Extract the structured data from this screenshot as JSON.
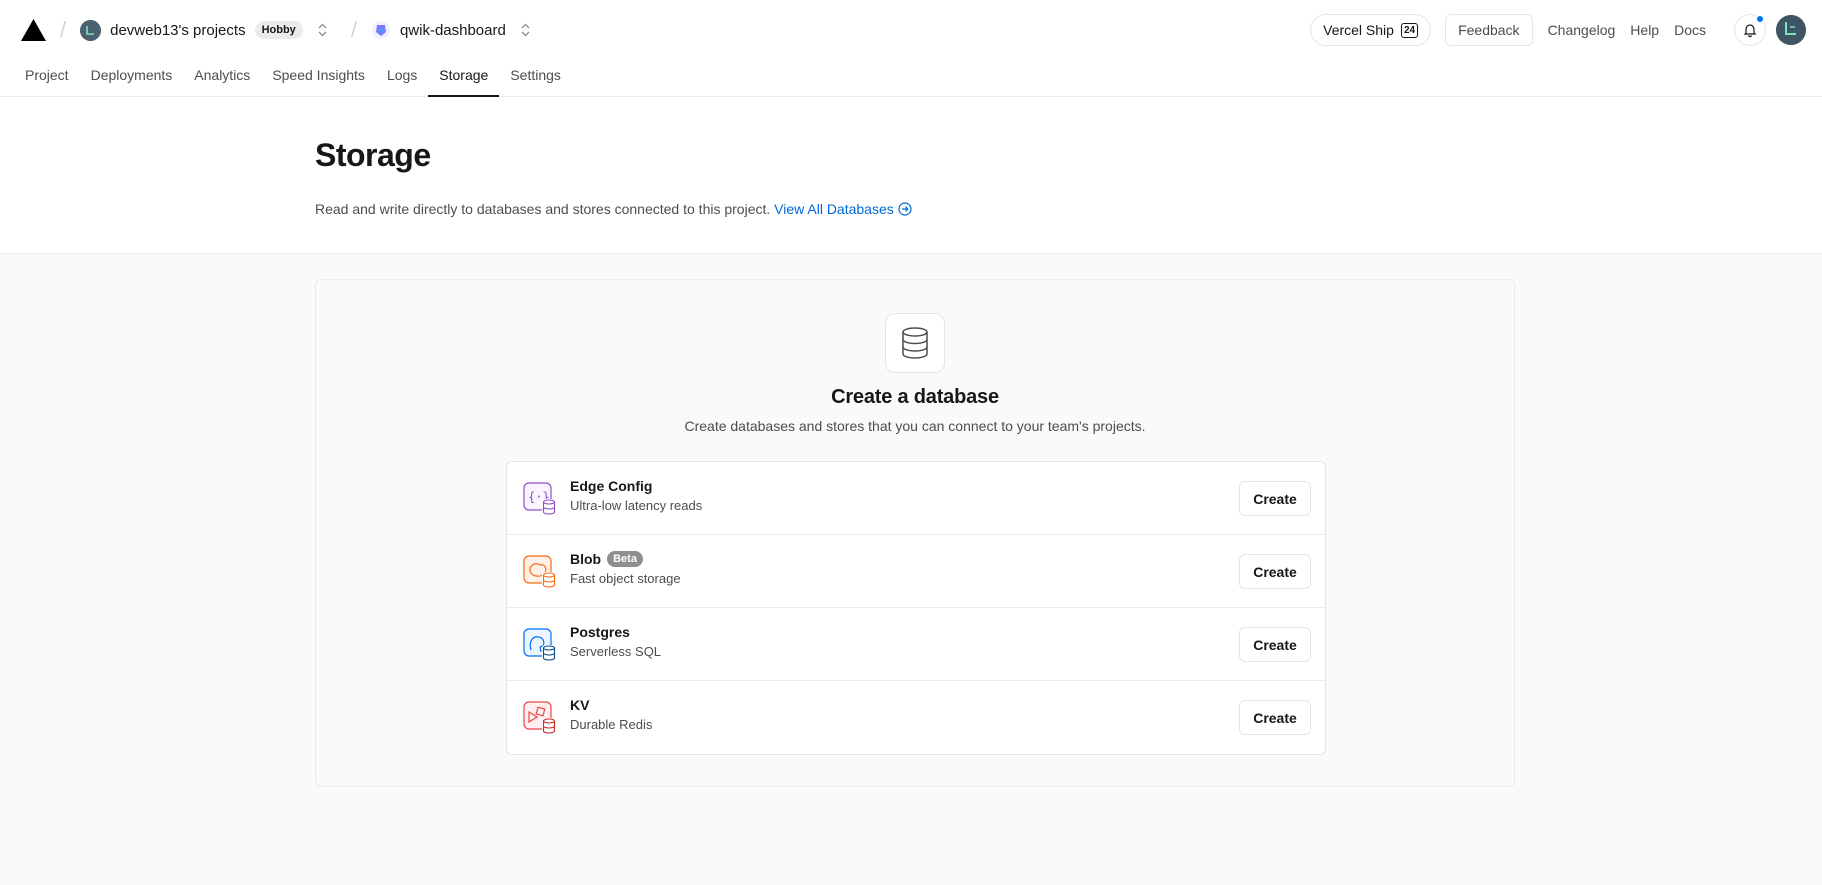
{
  "header": {
    "team_name": "devweb13's projects",
    "plan_badge": "Hobby",
    "project_name": "qwik-dashboard",
    "ship_label": "Vercel Ship",
    "ship_badge": "24",
    "feedback_label": "Feedback",
    "links": [
      "Changelog",
      "Help",
      "Docs"
    ]
  },
  "tabs": [
    "Project",
    "Deployments",
    "Analytics",
    "Speed Insights",
    "Logs",
    "Storage",
    "Settings"
  ],
  "active_tab": "Storage",
  "hero": {
    "title": "Storage",
    "description": "Read and write directly to databases and stores connected to this project.",
    "link_label": "View All Databases"
  },
  "panel": {
    "title": "Create a database",
    "subtitle": "Create databases and stores that you can connect to your team's projects.",
    "create_label": "Create",
    "items": [
      {
        "name": "Edge Config",
        "desc": "Ultra-low latency reads",
        "badge": "",
        "icon": "edge-config-icon",
        "color": "#8e4ec6"
      },
      {
        "name": "Blob",
        "desc": "Fast object storage",
        "badge": "Beta",
        "icon": "blob-icon",
        "color": "#f76b15"
      },
      {
        "name": "Postgres",
        "desc": "Serverless SQL",
        "badge": "",
        "icon": "postgres-icon",
        "color": "#0070f3"
      },
      {
        "name": "KV",
        "desc": "Durable Redis",
        "badge": "",
        "icon": "kv-icon",
        "color": "#e5484d"
      }
    ]
  }
}
